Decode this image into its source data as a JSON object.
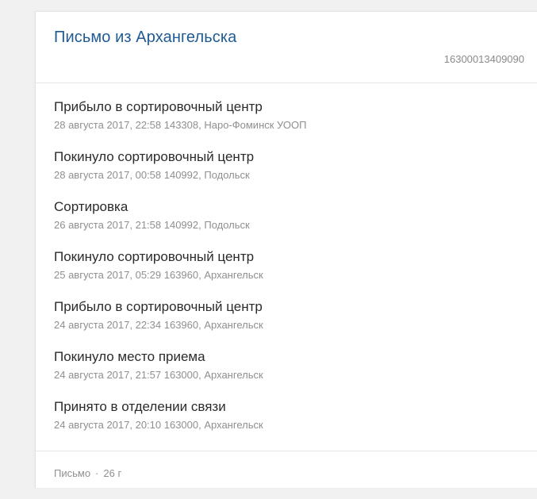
{
  "header": {
    "title": "Письмо из Архангельска",
    "tracking_number": "16300013409090"
  },
  "events": [
    {
      "title": "Прибыло в сортировочный центр",
      "meta": "28 августа 2017, 22:58 143308, Наро-Фоминск УООП"
    },
    {
      "title": "Покинуло сортировочный центр",
      "meta": "28 августа 2017, 00:58 140992, Подольск"
    },
    {
      "title": "Сортировка",
      "meta": "26 августа 2017, 21:58 140992, Подольск"
    },
    {
      "title": "Покинуло сортировочный центр",
      "meta": "25 августа 2017, 05:29 163960, Архангельск"
    },
    {
      "title": "Прибыло в сортировочный центр",
      "meta": "24 августа 2017, 22:34 163960, Архангельск"
    },
    {
      "title": "Покинуло место приема",
      "meta": "24 августа 2017, 21:57 163000, Архангельск"
    },
    {
      "title": "Принято в отделении связи",
      "meta": "24 августа 2017, 20:10 163000, Архангельск"
    }
  ],
  "footer": {
    "type": "Письмо",
    "separator": "·",
    "weight": "26 г"
  }
}
